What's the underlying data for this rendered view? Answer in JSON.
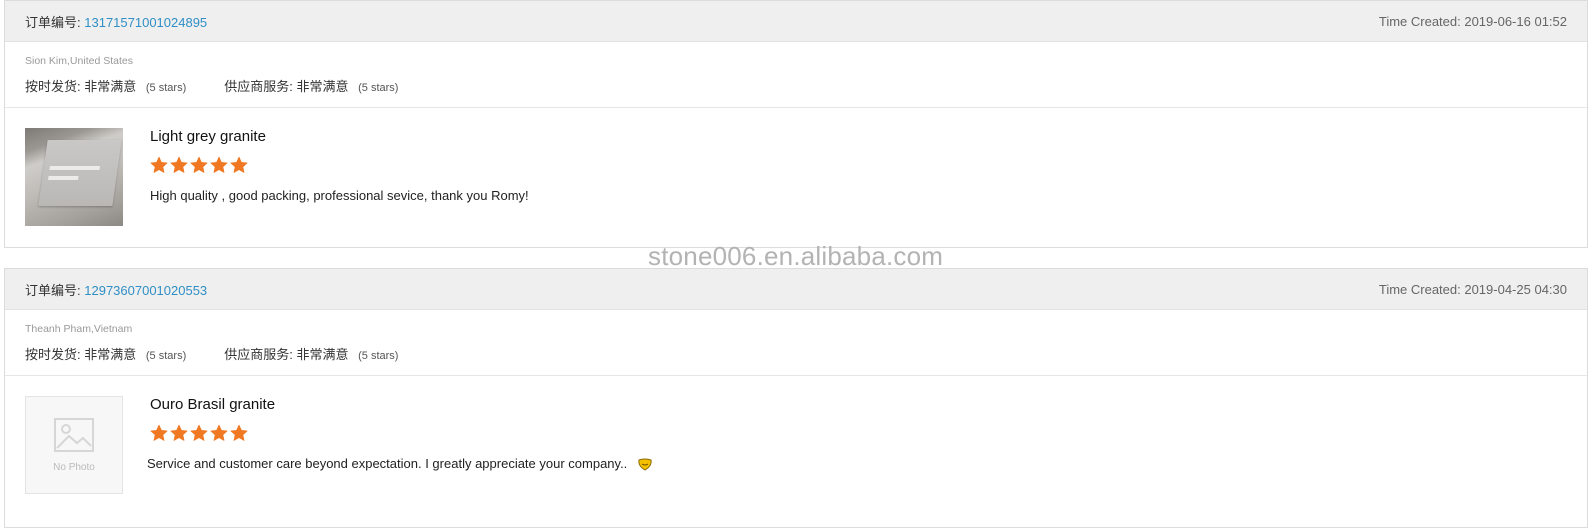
{
  "colors": {
    "link": "#2f8fc6",
    "star": "#f07822",
    "header_bg": "#efefef"
  },
  "watermark": "stone006.en.alibaba.com",
  "reviews": [
    {
      "order_label": "订单编号:",
      "order_number": "13171571001024895",
      "time_created": "Time Created: 2019-06-16 01:52",
      "buyer": "Sion Kim,United States",
      "shipping_label": "按时发货:",
      "shipping_value": "非常满意",
      "shipping_stars": "(5 stars)",
      "service_label": "供应商服务:",
      "service_value": "非常满意",
      "service_stars": "(5 stars)",
      "product_title": "Light grey granite",
      "rating": 5,
      "comment": "High quality , good packing, professional sevice, thank you Romy!",
      "image": "granite-slab-photo"
    },
    {
      "order_label": "订单编号:",
      "order_number": "12973607001020553",
      "time_created": "Time Created: 2019-04-25 04:30",
      "buyer": "Theanh Pham,Vietnam",
      "shipping_label": "按时发货:",
      "shipping_value": "非常满意",
      "shipping_stars": "(5 stars)",
      "service_label": "供应商服务:",
      "service_value": "非常满意",
      "service_stars": "(5 stars)",
      "product_title": "Ouro Brasil granite",
      "rating": 5,
      "comment": "Service and customer care beyond expectation.   I greatly appreciate your company..",
      "image": "no-photo-placeholder",
      "no_photo_text": "No Photo"
    }
  ]
}
